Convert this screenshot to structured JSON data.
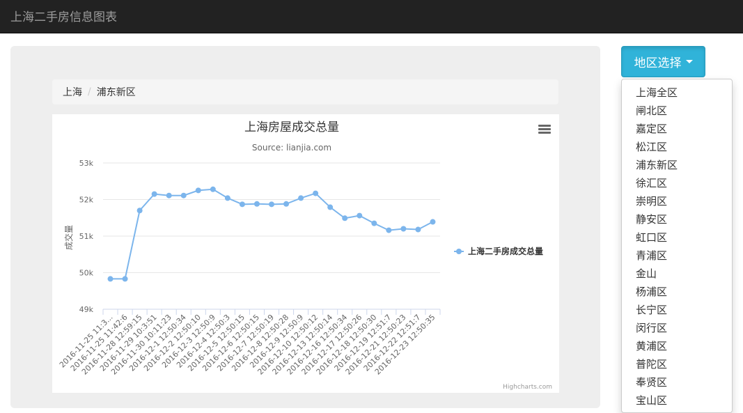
{
  "navbar": {
    "brand": "上海二手房信息图表"
  },
  "breadcrumb": {
    "items": [
      "上海",
      "浦东新区"
    ]
  },
  "region_dropdown": {
    "label": "地区选择",
    "items": [
      "上海全区",
      "闸北区",
      "嘉定区",
      "松江区",
      "浦东新区",
      "徐汇区",
      "崇明区",
      "静安区",
      "虹口区",
      "青浦区",
      "金山",
      "杨浦区",
      "长宁区",
      "闵行区",
      "黄浦区",
      "普陀区",
      "奉贤区",
      "宝山区"
    ]
  },
  "chart_data": {
    "type": "line",
    "title": "上海房屋成交总量",
    "subtitle": "Source: lianjia.com",
    "ylabel": "成交量",
    "xlabel": "",
    "ylim": [
      49000,
      53000
    ],
    "y_ticks": [
      "49k",
      "50k",
      "51k",
      "52k",
      "53k"
    ],
    "grid": true,
    "legend_position": "right",
    "categories": [
      "2016-11-25 11:3...",
      "2016-11-25 11:42:6",
      "2016-11-28 12:59:15",
      "2016-11-29 10:3:51",
      "2016-11-30 10:11:23",
      "2016-12-1 12:50:34",
      "2016-12-2 12:50:10",
      "2016-12-3 12:50:9",
      "2016-12-4 12:50:3",
      "2016-12-5 12:50:15",
      "2016-12-6 12:50:15",
      "2016-12-7 12:50:19",
      "2016-12-8 12:50:28",
      "2016-12-9 12:50:9",
      "2016-12-10 12:50:12",
      "2016-12-13 12:50:14",
      "2016-12-16 12:50:34",
      "2016-12-17 12:50:26",
      "2016-12-18 12:50:30",
      "2016-12-19 12:51:7",
      "2016-12-21 12:50:23",
      "2016-12-22 12:51:7",
      "2016-12-23 12:50:35"
    ],
    "series": [
      {
        "name": "上海二手房成交总量",
        "color": "#7cb5ec",
        "values": [
          49830,
          49830,
          51700,
          52150,
          52110,
          52110,
          52250,
          52280,
          52040,
          51870,
          51880,
          51870,
          51880,
          52040,
          52170,
          51790,
          51490,
          51560,
          51350,
          51160,
          51200,
          51180,
          51390
        ]
      }
    ],
    "credit": "Highcharts.com"
  }
}
